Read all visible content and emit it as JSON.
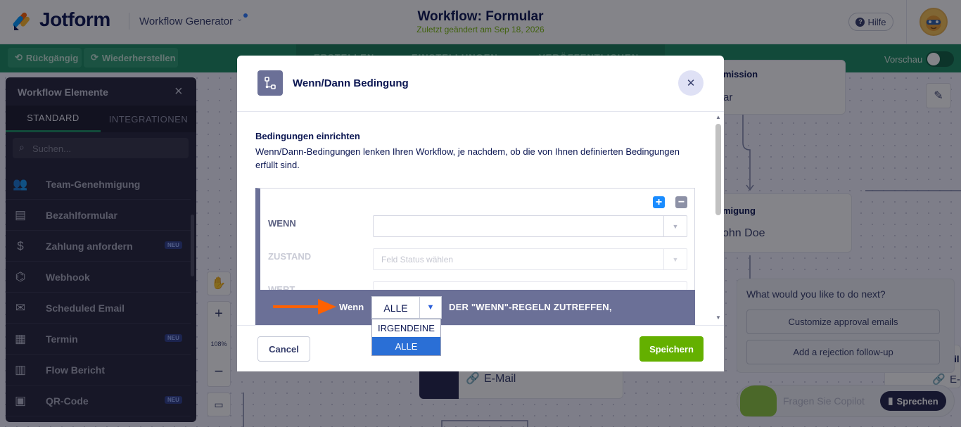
{
  "header": {
    "logo_text": "Jotform",
    "app_name": "Workflow Generator",
    "workflow_title": "Workflow: Formular",
    "workflow_subtitle": "Zuletzt geändert am Sep 18, 2026",
    "help_label": "Hilfe"
  },
  "toolbar": {
    "undo_label": "Rückgängig",
    "redo_label": "Wiederherstellen",
    "tabs": [
      "ERSTELLEN",
      "EINSTELLUNGEN",
      "VERÖFFENTLICHEN"
    ],
    "preview_label": "Vorschau"
  },
  "elements_panel": {
    "title": "Workflow Elemente",
    "tabs": [
      "STANDARD",
      "INTEGRATIONEN"
    ],
    "search_placeholder": "Suchen...",
    "items": [
      {
        "label": "Team-Genehmigung",
        "icon": "team-approval-icon",
        "badge": ""
      },
      {
        "label": "Bezahlformular",
        "icon": "payment-form-icon",
        "badge": ""
      },
      {
        "label": "Zahlung anfordern",
        "icon": "money-bag-icon",
        "badge": "NEU"
      },
      {
        "label": "Webhook",
        "icon": "webhook-icon",
        "badge": ""
      },
      {
        "label": "Scheduled Email",
        "icon": "scheduled-email-icon",
        "badge": ""
      },
      {
        "label": "Termin",
        "icon": "calendar-icon",
        "badge": "NEU"
      },
      {
        "label": "Flow Bericht",
        "icon": "report-icon",
        "badge": ""
      },
      {
        "label": "QR-Code",
        "icon": "qr-code-icon",
        "badge": "NEU"
      }
    ]
  },
  "zoom": {
    "level": "108%"
  },
  "canvas": {
    "node1_title": "mission",
    "node1_text": "ar",
    "node2_title": "migung",
    "node2_text": "ohn Doe",
    "node3_text": "E-Mail",
    "node4_title": "ail",
    "node4_text": "E-"
  },
  "next_steps": {
    "title": "What would you like to do next?",
    "buttons": [
      "Customize approval emails",
      "Add a rejection follow-up"
    ]
  },
  "copilot": {
    "placeholder": "Fragen Sie Copilot",
    "speak_label": "Sprechen"
  },
  "modal": {
    "title": "Wenn/Dann Bedingung",
    "section_title": "Bedingungen einrichten",
    "description": "Wenn/Dann-Bedingungen lenken Ihren Workflow, je nachdem, ob die von Ihnen definierten Bedingungen erfüllt sind.",
    "condition": {
      "if_label": "WENN",
      "state_label": "ZUSTAND",
      "value_label": "WERT",
      "if_value": "",
      "state_placeholder": "Feld Status wählen"
    },
    "rule_bar": {
      "prefix": "Wenn",
      "selected": "ALLE",
      "suffix": "DER \"WENN\"-REGELN ZUTREFFEN,",
      "options": [
        "IRGENDEINE",
        "ALLE"
      ]
    },
    "cancel_label": "Cancel",
    "save_label": "Speichern"
  },
  "colors": {
    "brand_green": "#1b8a60",
    "save_green": "#64b000",
    "condition_bar": "#6b7097",
    "arrow_orange": "#ff6100",
    "selected_option": "#2a6fd6"
  }
}
